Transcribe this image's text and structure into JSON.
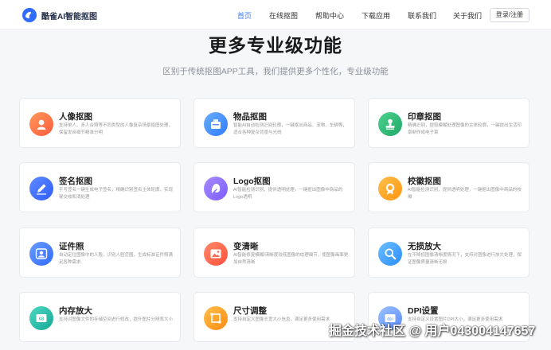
{
  "header": {
    "brand": "酷雀AI智能抠图",
    "nav": [
      "首页",
      "在线抠图",
      "帮助中心",
      "下载应用",
      "联系我们",
      "关于我们"
    ],
    "active_nav": "首页",
    "login_label": "登录/注册"
  },
  "section": {
    "title": "更多专业级功能",
    "subtitle": "区别于传统抠图APP工具，我们提供更多个性化，专业级功能"
  },
  "features": [
    {
      "title": "人像抠图",
      "desc": "支持单人、多人合照等不同类型的人像复杂场景抠图处理，保留发丝细节精准分明",
      "icon": "portrait-icon",
      "color": "#ff7a45"
    },
    {
      "title": "物品抠图",
      "desc": "智能AI自动检测识别轮廓，一键抠出商品、宠物、车辆等，适合各种复杂背景与光线",
      "icon": "object-icon",
      "color": "#3d8bff"
    },
    {
      "title": "印章抠图",
      "desc": "精确识别，提取模糊处理图像的主体轮廓，一键提出生活印章制作成电子章",
      "icon": "stamp-icon",
      "color": "#2bb673"
    },
    {
      "title": "签名抠图",
      "desc": "手写签名一键生成电子签名，精确识别签名主体轮廓，实现秘交收和消处理",
      "icon": "signature-icon",
      "color": "#3d6bff"
    },
    {
      "title": "Logo抠图",
      "desc": "AI智能检测识别，提供透明处理，一键抠出图像中商品的Logo透明",
      "icon": "logo-icon",
      "color": "#8b6cff"
    },
    {
      "title": "校徽抠图",
      "desc": "AI智能检测识别，提供透明处理，一键抠出图像中商品的校徽",
      "icon": "badge-icon",
      "color": "#ffa11a"
    },
    {
      "title": "证件照",
      "desc": "自动定位图像中的人脸，识别人脸范围，生成标准证件照满足各种需求",
      "icon": "id-photo-icon",
      "color": "#3d7cff"
    },
    {
      "title": "变清晰",
      "desc": "AI智能修复模糊/清晰度较低图像的纹理细节，使图像画面更加自然清晰",
      "icon": "enhance-icon",
      "color": "#ff6a4d"
    },
    {
      "title": "无损放大",
      "desc": "在不降低图像清晰度情况下，支持对图像进行放大处理，保证图像质量清晰无损",
      "icon": "zoom-icon",
      "color": "#3fa0ff"
    },
    {
      "title": "内存放大",
      "desc": "支持对图像文件的存储空间进行修改，提升图片分辨率大小",
      "icon": "memory-icon",
      "color": "#22b8a8"
    },
    {
      "title": "尺寸调整",
      "desc": "支持自定义图像长宽大小信息，满足更多使用需求",
      "icon": "resize-icon",
      "color": "#ff9d1a"
    },
    {
      "title": "DPI设置",
      "desc": "支持自定义设置图片DPI大小，满足更多使用需求",
      "icon": "dpi-icon",
      "color": "#6aa2ff"
    }
  ],
  "watermark": "掘金技术社区 @ 用户043004147657"
}
